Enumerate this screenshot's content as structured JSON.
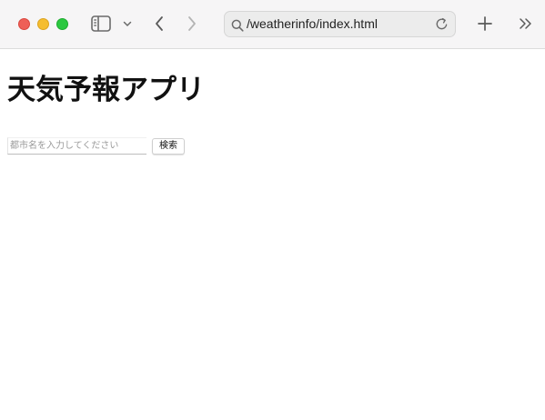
{
  "browser": {
    "url": "/weatherinfo/index.html",
    "icons": {
      "sidebar": "sidebar-icon",
      "sidebar_menu": "chevron-down-icon",
      "back": "chevron-left-icon",
      "forward": "chevron-right-icon",
      "search": "search-icon",
      "reload": "reload-icon",
      "new_tab": "plus-icon",
      "overflow": "double-chevron-right-icon"
    },
    "colors": {
      "close": "#ee5f57",
      "minimize": "#f5bd2f",
      "maximize": "#2bc840"
    }
  },
  "page": {
    "title": "天気予報アプリ",
    "search": {
      "placeholder": "都市名を入力してください",
      "value": "",
      "button_label": "検索"
    }
  }
}
